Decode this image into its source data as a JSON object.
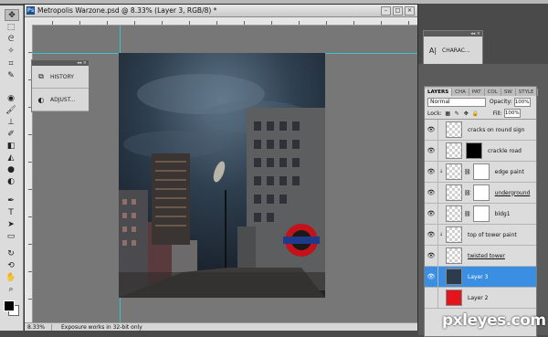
{
  "document": {
    "title": "Metropolis Warzone.psd @ 8.33% (Layer 3, RGB/8) *",
    "zoom": "8.33%",
    "status_info": "Exposure works in 32-bit only"
  },
  "panels": {
    "history_label": "HISTORY",
    "adjust_label": "ADJUST...",
    "character_label": "CHARAC..."
  },
  "layers_panel": {
    "tabs": [
      "LAYERS",
      "CHA",
      "PAT",
      "COL",
      "SW",
      "STYLE"
    ],
    "blend_mode": "Normal",
    "opacity_label": "Opacity:",
    "opacity_value": "100%",
    "lock_label": "Lock:",
    "fill_label": "Fill:",
    "fill_value": "100%",
    "layers": [
      {
        "name": "cracks on round sign"
      },
      {
        "name": "crackle road"
      },
      {
        "name": "edge paint"
      },
      {
        "name": "underground"
      },
      {
        "name": "bldg1"
      },
      {
        "name": "top of tower paint"
      },
      {
        "name": "twisted tower"
      },
      {
        "name": "Layer 3"
      },
      {
        "name": "Layer 2"
      }
    ]
  },
  "watermark": "pxleyes.com",
  "colors": {
    "accent_selected": "#3b8fe3",
    "guide": "#28d2d6",
    "layer2_fill": "#e3141c",
    "crackle_mask": "#000000"
  },
  "icons": [
    "move-icon",
    "marquee-icon",
    "lasso-icon",
    "magic-wand-icon",
    "crop-icon",
    "eyedropper-icon",
    "healing-icon",
    "brush-icon",
    "stamp-icon",
    "history-brush-icon",
    "eraser-icon",
    "gradient-icon",
    "blur-icon",
    "dodge-icon",
    "pen-icon",
    "type-icon",
    "path-select-icon",
    "shape-icon",
    "3d-rotate-icon",
    "3d-orbit-icon",
    "hand-icon",
    "zoom-icon"
  ]
}
